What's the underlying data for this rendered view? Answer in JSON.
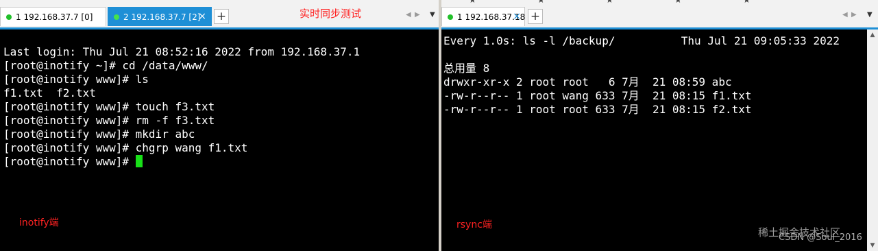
{
  "left_session": {
    "tabs": [
      {
        "label": "1 192.168.37.7 [0]",
        "active": false
      },
      {
        "label": "2 192.168.37.7 [2]",
        "active": true
      }
    ],
    "add_tab": "+",
    "annotation_title": "实时同步测试",
    "terminal_lines": [
      "Last login: Thu Jul 21 08:52:16 2022 from 192.168.37.1",
      "[root@inotify ~]# cd /data/www/",
      "[root@inotify www]# ls",
      "f1.txt  f2.txt",
      "[root@inotify www]# touch f3.txt",
      "[root@inotify www]# rm -f f3.txt",
      "[root@inotify www]# mkdir abc",
      "[root@inotify www]# chgrp wang f1.txt",
      "[root@inotify www]# "
    ],
    "annotation_side": "inotify端"
  },
  "right_session": {
    "tabs": [
      {
        "label": "1 192.168.37.18",
        "active": false
      }
    ],
    "add_tab": "+",
    "terminal_lines": [
      "Every 1.0s: ls -l /backup/          Thu Jul 21 09:05:33 2022",
      "",
      "总用量 8",
      "drwxr-xr-x 2 root root   6 7月  21 08:59 abc",
      "-rw-r--r-- 1 root wang 633 7月  21 08:15 f1.txt",
      "-rw-r--r-- 1 root root 633 7月  21 08:15 f2.txt"
    ],
    "annotation_side": "rsync端"
  },
  "watermark": {
    "line1": "稀土掘金技术社区",
    "line2": "CSDN @Soul_2016"
  },
  "icons": {
    "nav_prev": "triangle-left",
    "nav_next": "triangle-right",
    "menu": "triangle-down",
    "close": "x",
    "scroll_up": "triangle-up",
    "scroll_down": "triangle-down",
    "bookmark": "star"
  },
  "colors": {
    "tab_active": "#1e8fd6",
    "terminal_bg": "#000000",
    "terminal_fg": "#ffffff",
    "cursor": "#18e018",
    "annotation": "#ff2222",
    "status_dot": "#22c02a"
  }
}
